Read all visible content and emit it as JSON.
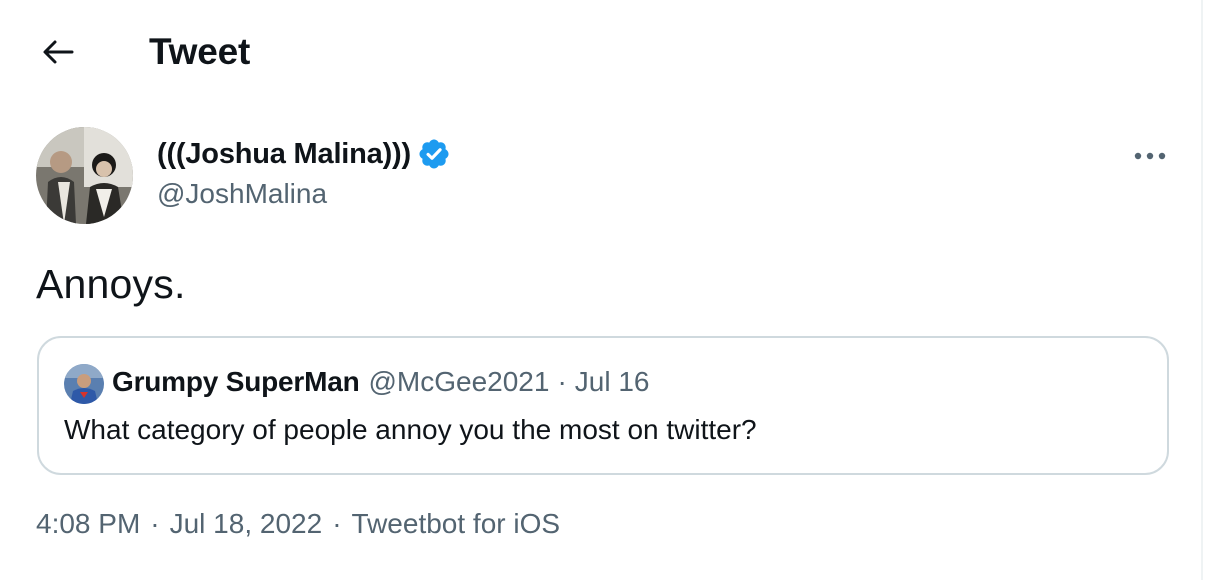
{
  "header": {
    "back_icon": "arrow-left-icon",
    "title": "Tweet"
  },
  "tweet": {
    "author": {
      "name": "(((Joshua Malina)))",
      "handle": "@JoshMalina",
      "verified": true,
      "verified_icon": "verified-badge-icon"
    },
    "more_icon": "more-horizontal-icon",
    "text": "Annoys.",
    "quoted": {
      "author_name": "Grumpy SuperMan",
      "author_handle": "@McGee2021",
      "separator": "·",
      "date": "Jul 16",
      "text": "What category of people annoy you the most on twitter?"
    },
    "meta": {
      "time": "4:08 PM",
      "date": "Jul 18, 2022",
      "source": "Tweetbot for iOS",
      "separator": "·"
    }
  },
  "colors": {
    "text_primary": "#0f1419",
    "text_secondary": "#536471",
    "verified_blue": "#1d9bf0",
    "border": "#cfd9de"
  }
}
